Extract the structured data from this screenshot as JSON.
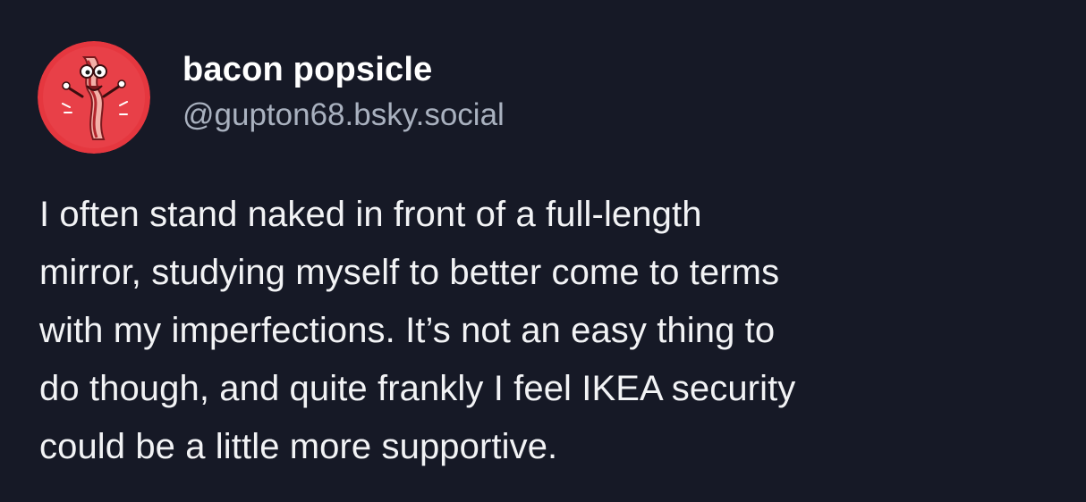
{
  "post": {
    "author": {
      "display_name": "bacon popsicle",
      "handle": "@gupton68.bsky.social",
      "avatar_icon": "bacon-character-avatar",
      "avatar_color": "#e5373f"
    },
    "text": "I often stand naked in front of a full-length\nmirror, studying myself to better come to terms\nwith my imperfections. It’s not an easy thing to\ndo though, and quite frankly I feel IKEA security\ncould be a little more supportive."
  },
  "colors": {
    "background": "#161926",
    "name": "#ffffff",
    "handle": "#a9b1bf",
    "text": "#f2f3f5"
  }
}
